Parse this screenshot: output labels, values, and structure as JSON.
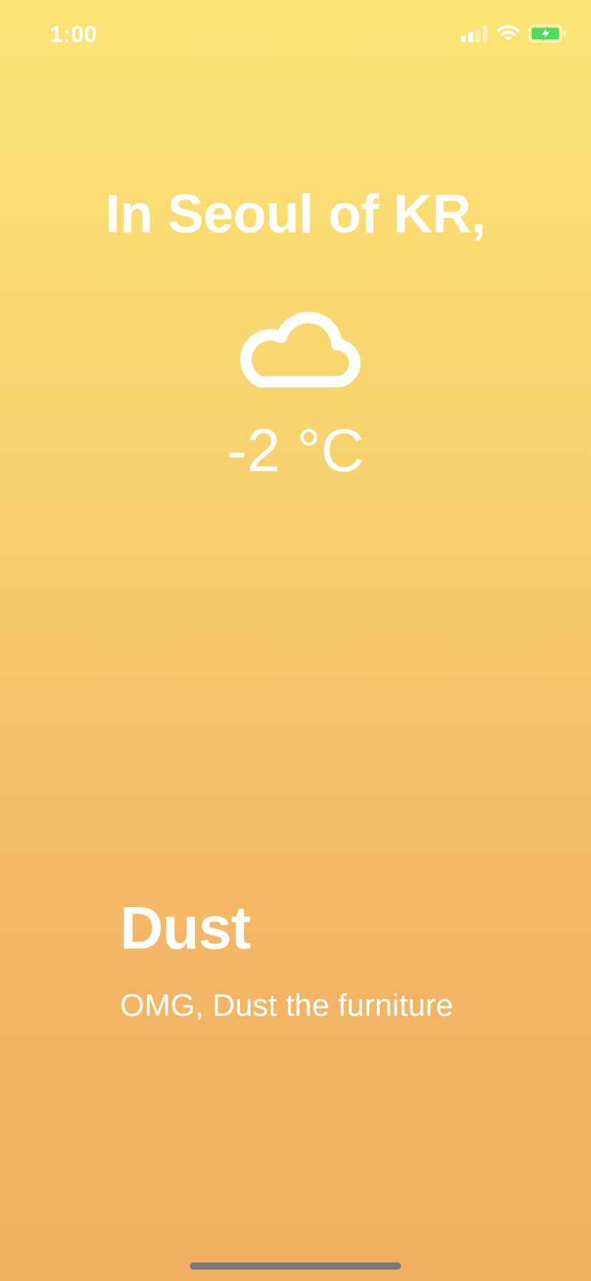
{
  "status_bar": {
    "time": "1:00",
    "signal_icon": "cellular-signal-icon",
    "wifi_icon": "wifi-icon",
    "battery_icon": "battery-charging-icon",
    "battery_color": "#4cd964"
  },
  "weather": {
    "city_line": "In Seoul of KR,",
    "icon": "cloud-icon",
    "temperature": "-2 °C"
  },
  "condition": {
    "title": "Dust",
    "message": "OMG, Dust the furniture"
  },
  "colors": {
    "gradient_top": "#fbe574",
    "gradient_bottom": "#f2ae62",
    "text": "#ffffff"
  }
}
